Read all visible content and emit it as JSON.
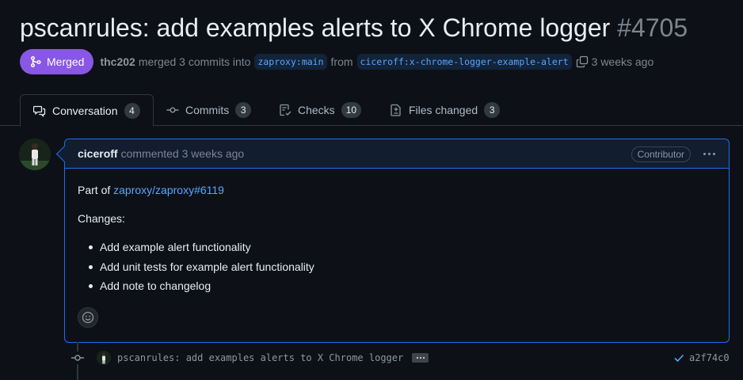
{
  "pr": {
    "title": "pscanrules: add examples alerts to X Chrome logger",
    "number": "#4705",
    "state_label": "Merged",
    "merged_by": "thc202",
    "merged_text": "merged 3 commits into",
    "base_branch": "zaproxy:main",
    "from_text": "from",
    "head_branch": "ciceroff:x-chrome-logger-example-alert",
    "time_ago": "3 weeks ago"
  },
  "tabs": [
    {
      "label": "Conversation",
      "count": "4",
      "icon": "comment-discussion-icon"
    },
    {
      "label": "Commits",
      "count": "3",
      "icon": "git-commit-icon"
    },
    {
      "label": "Checks",
      "count": "10",
      "icon": "checklist-icon"
    },
    {
      "label": "Files changed",
      "count": "3",
      "icon": "file-diff-icon"
    }
  ],
  "comment": {
    "author": "ciceroff",
    "action": "commented 3 weeks ago",
    "role": "Contributor",
    "part_of_prefix": "Part of",
    "part_of_link": "zaproxy/zaproxy#6119",
    "changes_heading": "Changes:",
    "items": [
      "Add example alert functionality",
      "Add unit tests for example alert functionality",
      "Add note to changelog"
    ]
  },
  "commit": {
    "message": "pscanrules: add examples alerts to X Chrome logger",
    "sha": "a2f74c0",
    "status": "success"
  },
  "colors": {
    "merged": "#8957e5",
    "link": "#58a6ff",
    "background": "#0d1117",
    "comment_border": "#1f6feb"
  }
}
